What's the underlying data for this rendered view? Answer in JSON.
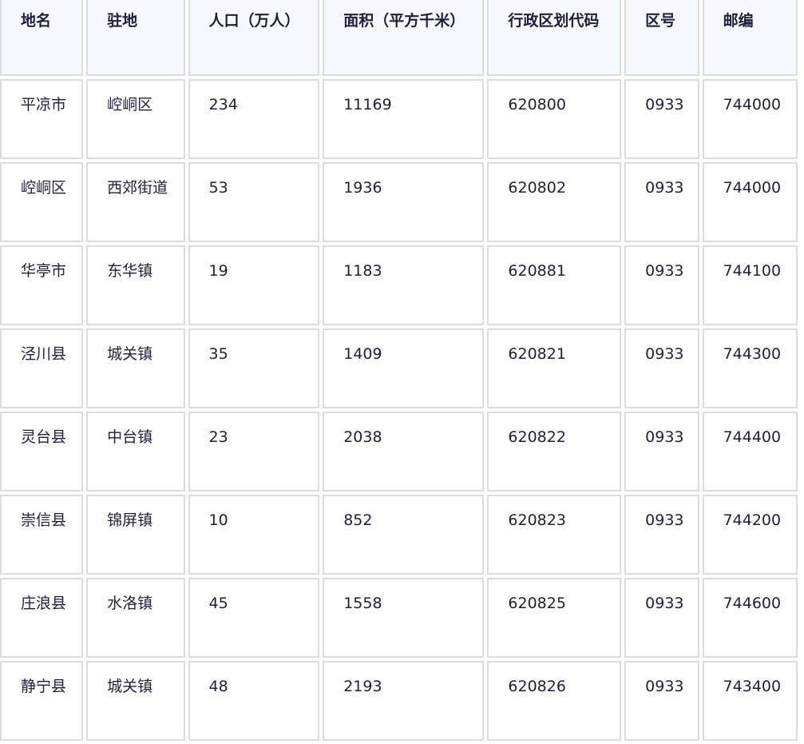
{
  "table": {
    "headers": [
      "地名",
      "驻地",
      "人口（万人）",
      "面积（平方千米）",
      "行政区划代码",
      "区号",
      "邮编"
    ],
    "rows": [
      [
        "平凉市",
        "崆峒区",
        "234",
        "11169",
        "620800",
        "0933",
        "744000"
      ],
      [
        "崆峒区",
        "西郊街道",
        "53",
        "1936",
        "620802",
        "0933",
        "744000"
      ],
      [
        "华亭市",
        "东华镇",
        "19",
        "1183",
        "620881",
        "0933",
        "744100"
      ],
      [
        "泾川县",
        "城关镇",
        "35",
        "1409",
        "620821",
        "0933",
        "744300"
      ],
      [
        "灵台县",
        "中台镇",
        "23",
        "2038",
        "620822",
        "0933",
        "744400"
      ],
      [
        "崇信县",
        "锦屏镇",
        "10",
        "852",
        "620823",
        "0933",
        "744200"
      ],
      [
        "庄浪县",
        "水洛镇",
        "45",
        "1558",
        "620825",
        "0933",
        "744600"
      ],
      [
        "静宁县",
        "城关镇",
        "48",
        "2193",
        "620826",
        "0933",
        "743400"
      ]
    ]
  }
}
